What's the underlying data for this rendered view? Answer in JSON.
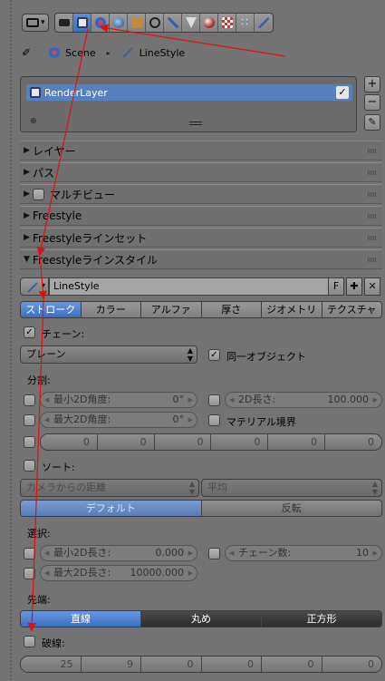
{
  "header": {
    "context_buttons": [
      "render-icon",
      "render-layers-icon",
      "scene-icon",
      "world-icon",
      "object-icon",
      "constraints-icon",
      "modifiers-icon",
      "data-icon",
      "material-icon",
      "texture-icon",
      "particles-icon",
      "physics-icon"
    ],
    "active_context": 1
  },
  "breadcrumb": {
    "scene": "Scene",
    "linestyle": "LineStyle"
  },
  "render_layers": {
    "items": [
      "RenderLayer"
    ]
  },
  "panels": {
    "layer": "レイヤー",
    "pass": "パス",
    "multiview": "マルチビュー",
    "freestyle": "Freestyle",
    "lineset": "Freestyleラインセット",
    "linestyle": "Freestyleラインスタイル"
  },
  "linestyle": {
    "name": "LineStyle",
    "fake_user": "F",
    "tabs": [
      "ストローク",
      "カラー",
      "アルファ",
      "厚さ",
      "ジオメトリ",
      "テクスチャ"
    ],
    "active_tab": 0,
    "chaining_label": "チェーン:",
    "chain_type": "プレーン",
    "same_object": "同一オブジェクト",
    "split_label": "分割:",
    "min_2d_angle": {
      "label": "最小2D角度:",
      "value": "0°"
    },
    "max_2d_angle": {
      "label": "最大2D角度:",
      "value": "0°"
    },
    "length_2d": {
      "label": "2D長さ:",
      "value": "100.000"
    },
    "material_boundary": "マテリアル境界",
    "dash_fields": [
      "0",
      "0",
      "0",
      "0",
      "0",
      "0"
    ],
    "sort_label": "ソート:",
    "sort_key": "カメラからの距離",
    "sort_integ": "平均",
    "sort_order": [
      "デフォルト",
      "反転"
    ],
    "select_label": "選択:",
    "min_2d_length": {
      "label": "最小2D長さ:",
      "value": "0.000"
    },
    "max_2d_length": {
      "label": "最大2D長さ:",
      "value": "10000.000"
    },
    "chain_count": {
      "label": "チェーン数:",
      "value": "10"
    },
    "caps_label": "先端:",
    "caps": [
      "直線",
      "丸め",
      "正方形"
    ],
    "dashed_line": "破線:",
    "dash_values": [
      "25",
      "9",
      "0",
      "0",
      "0",
      "0"
    ]
  }
}
